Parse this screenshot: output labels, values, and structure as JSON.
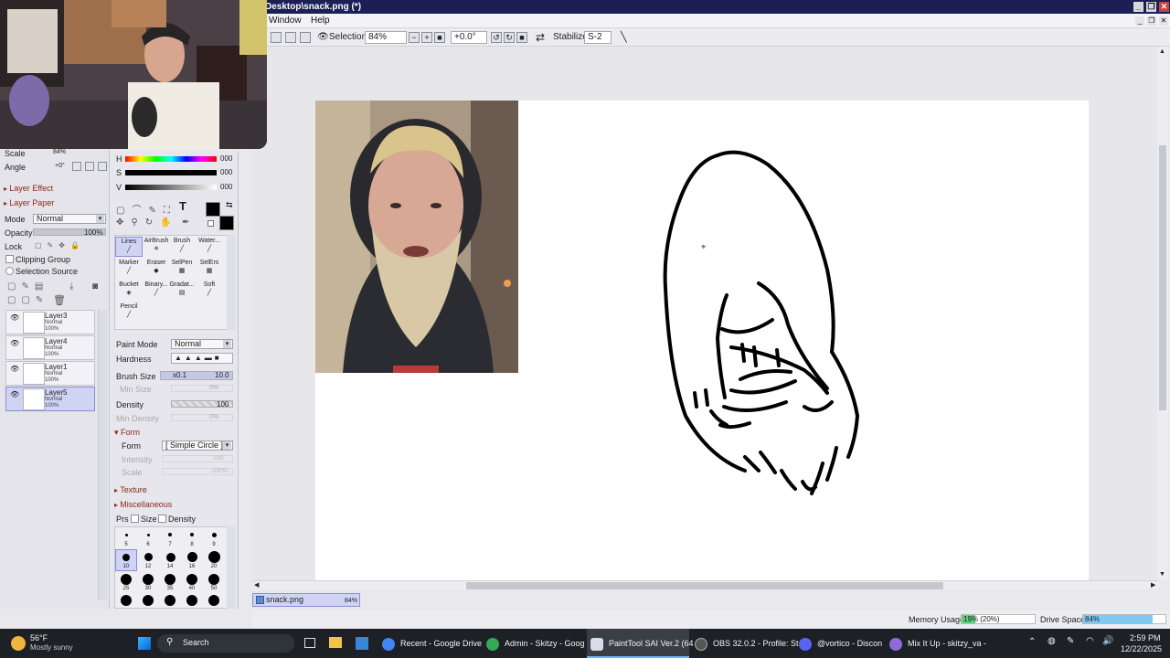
{
  "window": {
    "title": "Desktop\\snack.png (*)"
  },
  "menu": {
    "items": [
      "Window",
      "Help"
    ]
  },
  "toolbar": {
    "selection_label": "Selection",
    "zoom": "84%",
    "rotation": "+0.0°",
    "stabilizer_label": "Stabilizer",
    "stabilizer_value": "S-2"
  },
  "navigator": {
    "scale_label": "Scale",
    "scale_value": "84%",
    "angle_label": "Angle",
    "angle_value": "+0°"
  },
  "layer_panel": {
    "layer_effect": "Layer Effect",
    "layer_paper": "Layer Paper",
    "mode_label": "Mode",
    "mode_value": "Normal",
    "opacity_label": "Opacity",
    "opacity_value": "100%",
    "lock_label": "Lock",
    "clipping_group": "Clipping Group",
    "selection_source": "Selection Source",
    "layers": [
      {
        "name": "Layer3",
        "mode": "Normal",
        "opacity": "100%"
      },
      {
        "name": "Layer4",
        "mode": "Normal",
        "opacity": "100%"
      },
      {
        "name": "Layer1",
        "mode": "Normal",
        "opacity": "100%"
      },
      {
        "name": "Layer5",
        "mode": "Normal",
        "opacity": "100%",
        "selected": true
      }
    ]
  },
  "color": {
    "h_label": "H",
    "h_value": "000",
    "s_label": "S",
    "s_value": "000",
    "v_label": "V",
    "v_value": "000",
    "fg": "#000000",
    "bg": "#000000"
  },
  "brushes": [
    {
      "name": "Lines"
    },
    {
      "name": "AirBrush"
    },
    {
      "name": "Brush"
    },
    {
      "name": "Water..."
    },
    {
      "name": "Marker"
    },
    {
      "name": "Eraser"
    },
    {
      "name": "SelPen"
    },
    {
      "name": "SelErs"
    },
    {
      "name": "Bucket"
    },
    {
      "name": "Binary..."
    },
    {
      "name": "Gradat..."
    },
    {
      "name": "Soft"
    },
    {
      "name": "Pencil"
    }
  ],
  "brush_settings": {
    "paint_mode_label": "Paint Mode",
    "paint_mode_value": "Normal",
    "hardness_label": "Hardness",
    "brush_size_label": "Brush Size",
    "brush_size_mult": "x0.1",
    "brush_size_value": "10.0",
    "min_size_label": "Min Size",
    "min_size_value": "0%",
    "density_label": "Density",
    "density_value": "100",
    "min_density_label": "Min Density",
    "min_density_value": "0%",
    "form_section": "Form",
    "form_label": "Form",
    "form_value": "[ Simple Circle ]",
    "intensity_label": "Intensity",
    "intensity_value": "100",
    "scale_label": "Scale",
    "scale_value": "100%",
    "texture_section": "Texture",
    "misc_section": "Miscellaneous",
    "prs_label": "Prs",
    "size_label": "Size",
    "density_chk_label": "Density"
  },
  "brush_sizes": [
    "5",
    "6",
    "7",
    "8",
    "9",
    "10",
    "12",
    "14",
    "16",
    "20",
    "25",
    "30",
    "35",
    "40",
    "50"
  ],
  "document": {
    "tab_name": "snack.png",
    "tab_zoom": "84%"
  },
  "status": {
    "memory_label": "Memory Usage",
    "memory_value": "19% (20%)",
    "memory_fraction": 0.19,
    "drive_label": "Drive Space",
    "drive_value": "84%",
    "drive_fraction": 0.84
  },
  "taskbar": {
    "weather_temp": "56°F",
    "weather_desc": "Mostly sunny",
    "search": "Search",
    "apps": [
      {
        "label": "Recent - Google Drive",
        "color": "#4285f4"
      },
      {
        "label": "Admin - Skitzy - Goog",
        "color": "#34a853"
      },
      {
        "label": "PaintTool SAI Ver.2 (64",
        "color": "#d9dbe8"
      },
      {
        "label": "OBS 32.0.2 - Profile: St",
        "color": "#555555"
      },
      {
        "label": "@vortico - Discon",
        "color": "#5865f2"
      },
      {
        "label": "Mix It Up - skitzy_va -",
        "color": "#8e6bd8"
      }
    ],
    "time": "2:59 PM",
    "date": "12/22/2025"
  }
}
